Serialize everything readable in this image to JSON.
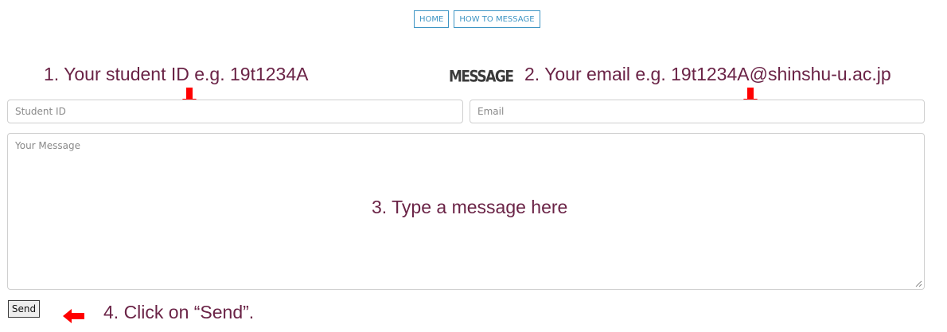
{
  "nav": {
    "items": [
      {
        "label": "HOME"
      },
      {
        "label": "HOW TO MESSAGE"
      }
    ],
    "color": "#3e95c4"
  },
  "form": {
    "heading": "MESSAGE",
    "student_id": {
      "placeholder": "Student ID",
      "value": ""
    },
    "email": {
      "placeholder": "Email",
      "value": ""
    },
    "message": {
      "placeholder": "Your Message",
      "value": ""
    },
    "send_label": "Send"
  },
  "annotations": {
    "step1": "1. Your student ID e.g. 19t1234A",
    "step2": "2. Your email e.g. 19t1234A@shinshu-u.ac.jp",
    "step3": "3. Type a message here",
    "step4": "4. Click on “Send”.",
    "text_color": "#6a2346",
    "arrow_color": "#ff0000",
    "arrow_icons": [
      "arrow-down-icon",
      "arrow-down-icon",
      "arrow-left-icon"
    ]
  }
}
